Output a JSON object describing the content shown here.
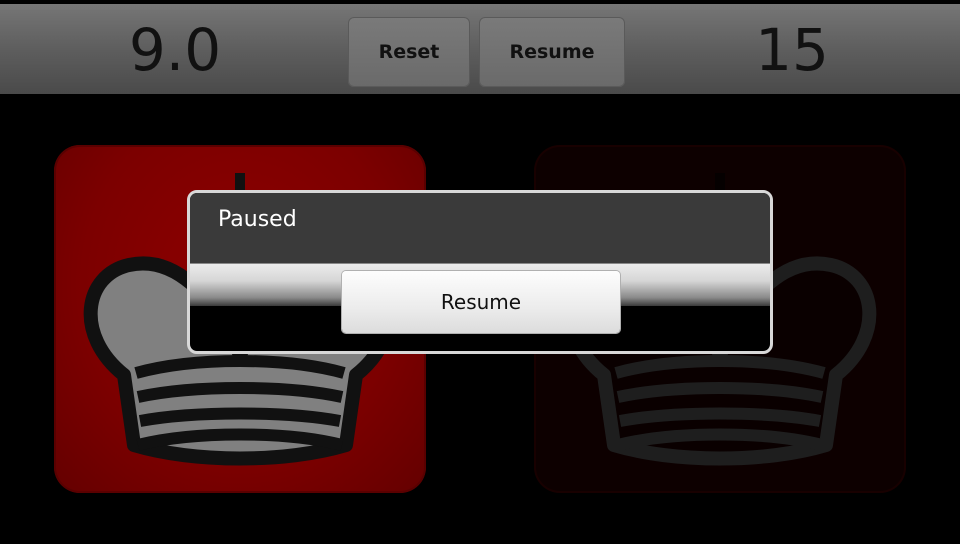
{
  "topbar": {
    "left_clock": "9.0",
    "right_clock": "15",
    "reset_label": "Reset",
    "resume_label": "Resume"
  },
  "tiles": {
    "left": {
      "piece": "king-icon",
      "active": true,
      "color": "#8e0000"
    },
    "right": {
      "piece": "king-icon",
      "active": false,
      "color": "#0d0000"
    }
  },
  "dialog": {
    "title": "Paused",
    "button_label": "Resume"
  }
}
